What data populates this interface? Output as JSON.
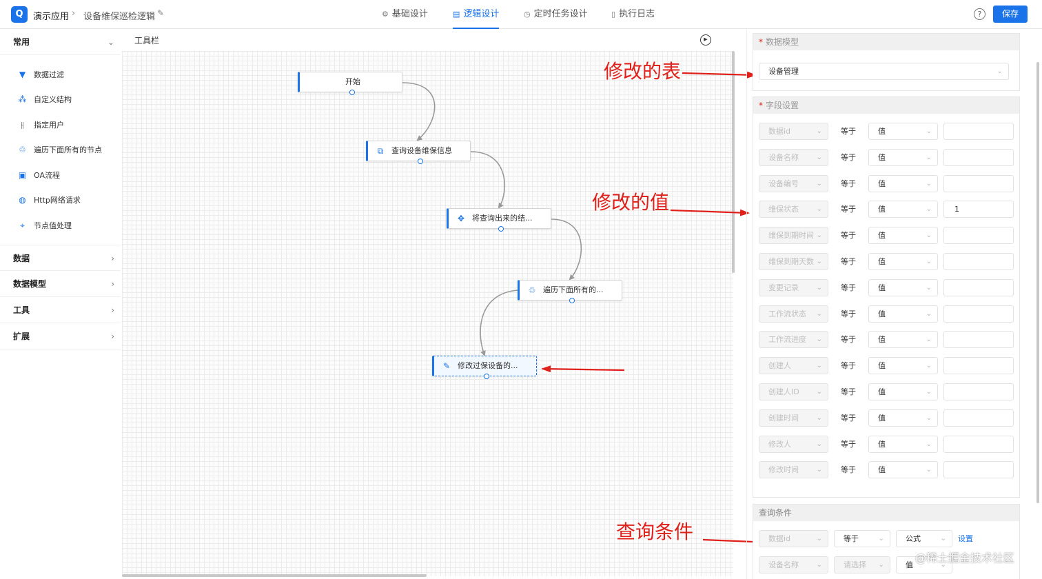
{
  "header": {
    "app_name": "演示应用",
    "breadcrumb_sep": "›",
    "page_name": "设备维保巡检逻辑",
    "tabs": [
      {
        "label": "基础设计",
        "icon": "gear-icon",
        "active": false
      },
      {
        "label": "逻辑设计",
        "icon": "layout-icon",
        "active": true
      },
      {
        "label": "定时任务设计",
        "icon": "clock-icon",
        "active": false
      },
      {
        "label": "执行日志",
        "icon": "document-icon",
        "active": false
      }
    ],
    "save_label": "保存",
    "help_symbol": "?"
  },
  "sidebar": {
    "groups": [
      {
        "label": "常用",
        "expanded": true
      },
      {
        "label": "数据",
        "expanded": false
      },
      {
        "label": "数据模型",
        "expanded": false
      },
      {
        "label": "工具",
        "expanded": false
      },
      {
        "label": "扩展",
        "expanded": false
      }
    ],
    "items": [
      {
        "label": "数据过滤",
        "icon": "filter-icon"
      },
      {
        "label": "自定义结构",
        "icon": "structure-icon"
      },
      {
        "label": "指定用户",
        "icon": "sliders-icon"
      },
      {
        "label": "遍历下面所有的节点",
        "icon": "loop-icon"
      },
      {
        "label": "OA流程",
        "icon": "flow-icon"
      },
      {
        "label": "Http网络请求",
        "icon": "globe-icon"
      },
      {
        "label": "节点值处理",
        "icon": "node-icon"
      }
    ]
  },
  "canvas": {
    "toolbar_label": "工具栏",
    "nodes": [
      {
        "label": "开始",
        "icon": "",
        "selected": false
      },
      {
        "label": "查询设备维保信息",
        "icon": "query-icon",
        "selected": false
      },
      {
        "label": "将查询出来的结...",
        "icon": "move-icon",
        "selected": false
      },
      {
        "label": "遍历下面所有的...",
        "icon": "loop-icon",
        "selected": false
      },
      {
        "label": "修改过保设备的...",
        "icon": "edit-icon",
        "selected": true
      }
    ]
  },
  "annotations": {
    "modified_table": "修改的表",
    "modified_value": "修改的值",
    "query_condition": "查询条件",
    "color": "#e0201a"
  },
  "right_panel": {
    "data_model": {
      "title": "数据模型",
      "required": true,
      "selected": "设备管理"
    },
    "field_settings": {
      "title": "字段设置",
      "required": true,
      "rows": [
        {
          "field": "数据id",
          "op": "等于",
          "type": "值",
          "value": ""
        },
        {
          "field": "设备名称",
          "op": "等于",
          "type": "值",
          "value": ""
        },
        {
          "field": "设备编号",
          "op": "等于",
          "type": "值",
          "value": ""
        },
        {
          "field": "维保状态",
          "op": "等于",
          "type": "值",
          "value": "1"
        },
        {
          "field": "维保到期时间",
          "op": "等于",
          "type": "值",
          "value": ""
        },
        {
          "field": "维保到期天数",
          "op": "等于",
          "type": "值",
          "value": ""
        },
        {
          "field": "变更记录",
          "op": "等于",
          "type": "值",
          "value": ""
        },
        {
          "field": "工作流状态",
          "op": "等于",
          "type": "值",
          "value": ""
        },
        {
          "field": "工作流进度",
          "op": "等于",
          "type": "值",
          "value": ""
        },
        {
          "field": "创建人",
          "op": "等于",
          "type": "值",
          "value": ""
        },
        {
          "field": "创建人ID",
          "op": "等于",
          "type": "值",
          "value": ""
        },
        {
          "field": "创建时间",
          "op": "等于",
          "type": "值",
          "value": ""
        },
        {
          "field": "修改人",
          "op": "等于",
          "type": "值",
          "value": ""
        },
        {
          "field": "修改时间",
          "op": "等于",
          "type": "值",
          "value": ""
        }
      ]
    },
    "query_conditions": {
      "title": "查询条件",
      "rows": [
        {
          "field": "数据id",
          "op": "等于",
          "type": "公式",
          "action": "设置"
        },
        {
          "field": "设备名称",
          "op": "请选择",
          "type": "值",
          "action": ""
        }
      ]
    }
  },
  "watermark": "@稀土掘金技术社区"
}
